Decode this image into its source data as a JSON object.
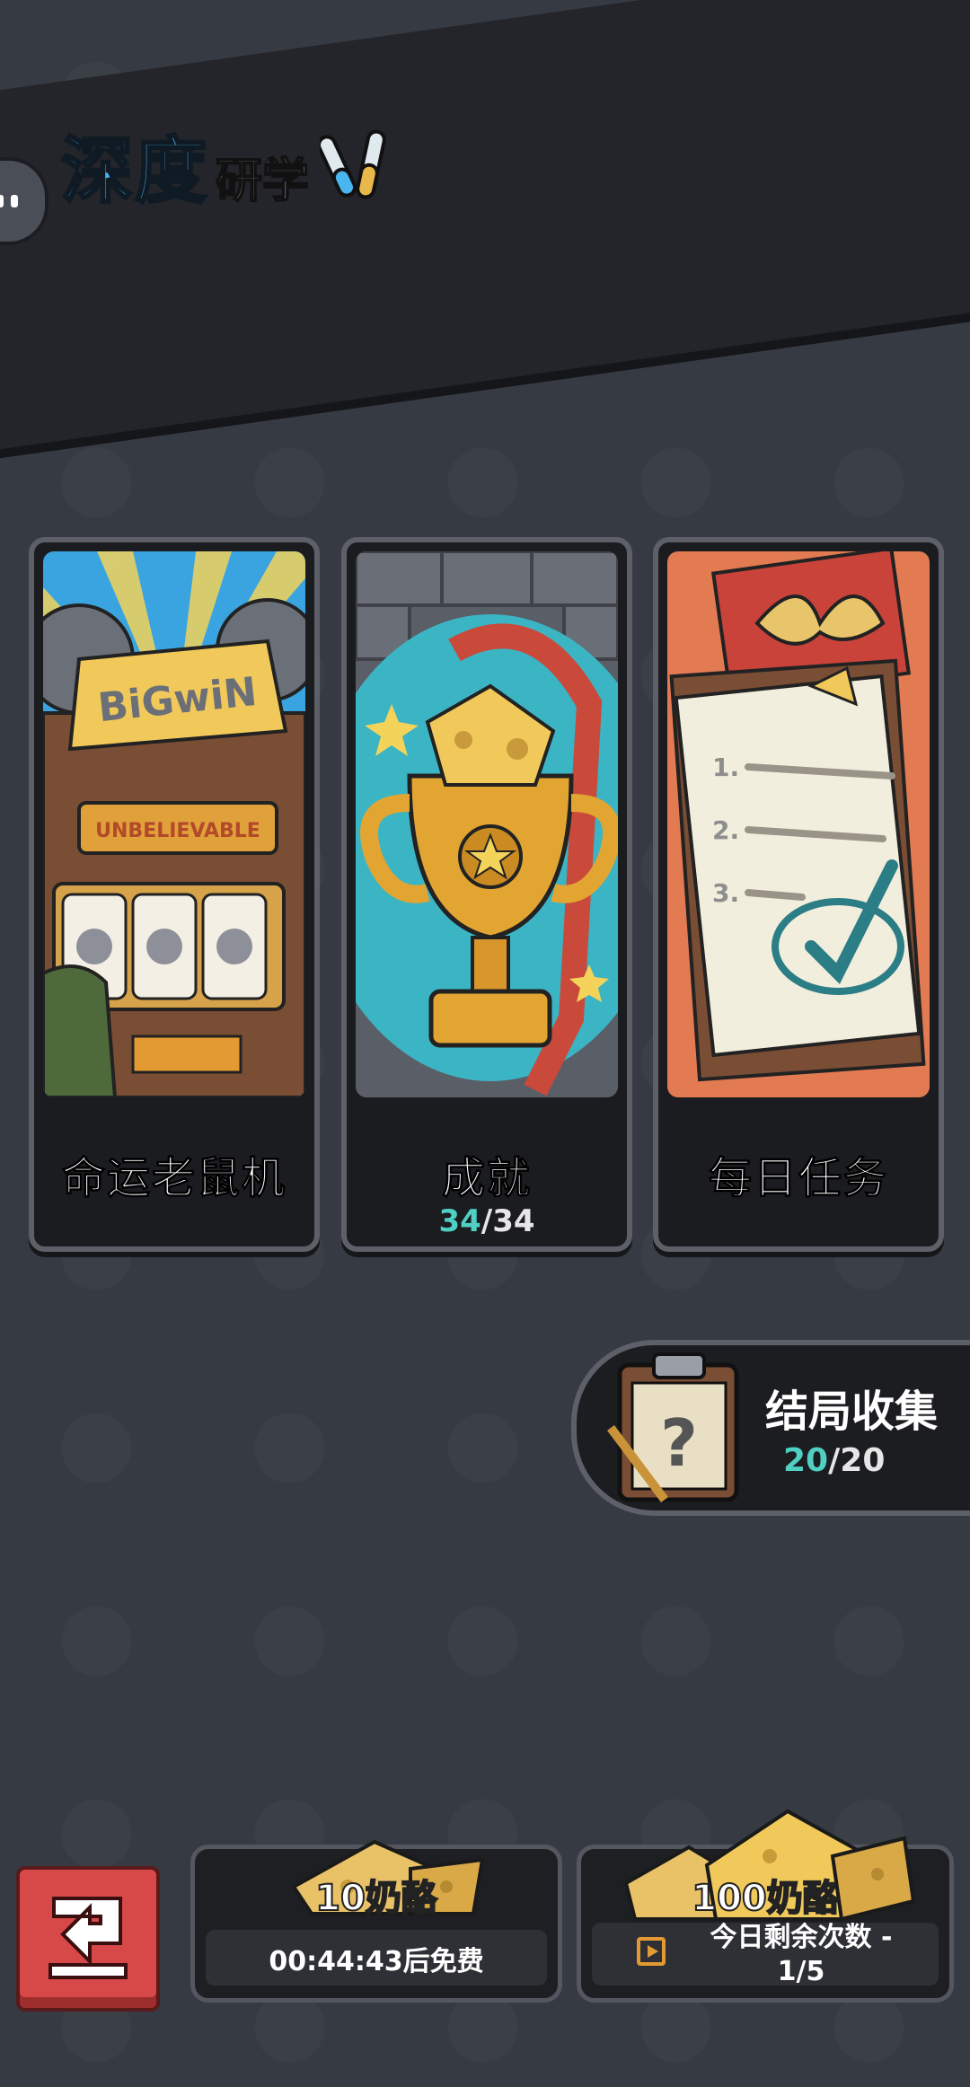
{
  "header": {
    "title_main": "深度",
    "title_sub": "研学"
  },
  "cards": [
    {
      "label": "命运老鼠机",
      "art_icon": "slot-machine-icon",
      "art_text_1": "BiGwiN",
      "art_text_2": "UNBELIEVABLE"
    },
    {
      "label": "成就",
      "art_icon": "trophy-icon",
      "progress_current": "34",
      "progress_sep": "/",
      "progress_total": "34"
    },
    {
      "label": "每日任务",
      "art_icon": "task-list-icon",
      "list_nums": [
        "1.",
        "2.",
        "3."
      ]
    }
  ],
  "endings": {
    "label": "结局收集",
    "progress_current": "20",
    "progress_sep": "/",
    "progress_total": "20"
  },
  "bottom": {
    "small_pack": {
      "title": "10奶酪",
      "subtitle": "00:44:43后免费"
    },
    "big_pack": {
      "title": "100奶酪",
      "subtitle_line1": "今日剩余次数 -",
      "subtitle_line2": "1/5"
    }
  },
  "colors": {
    "accent_blue": "#4ab6f0",
    "teal": "#4fd0c3",
    "background": "#363a42",
    "back_button": "#d74848"
  }
}
